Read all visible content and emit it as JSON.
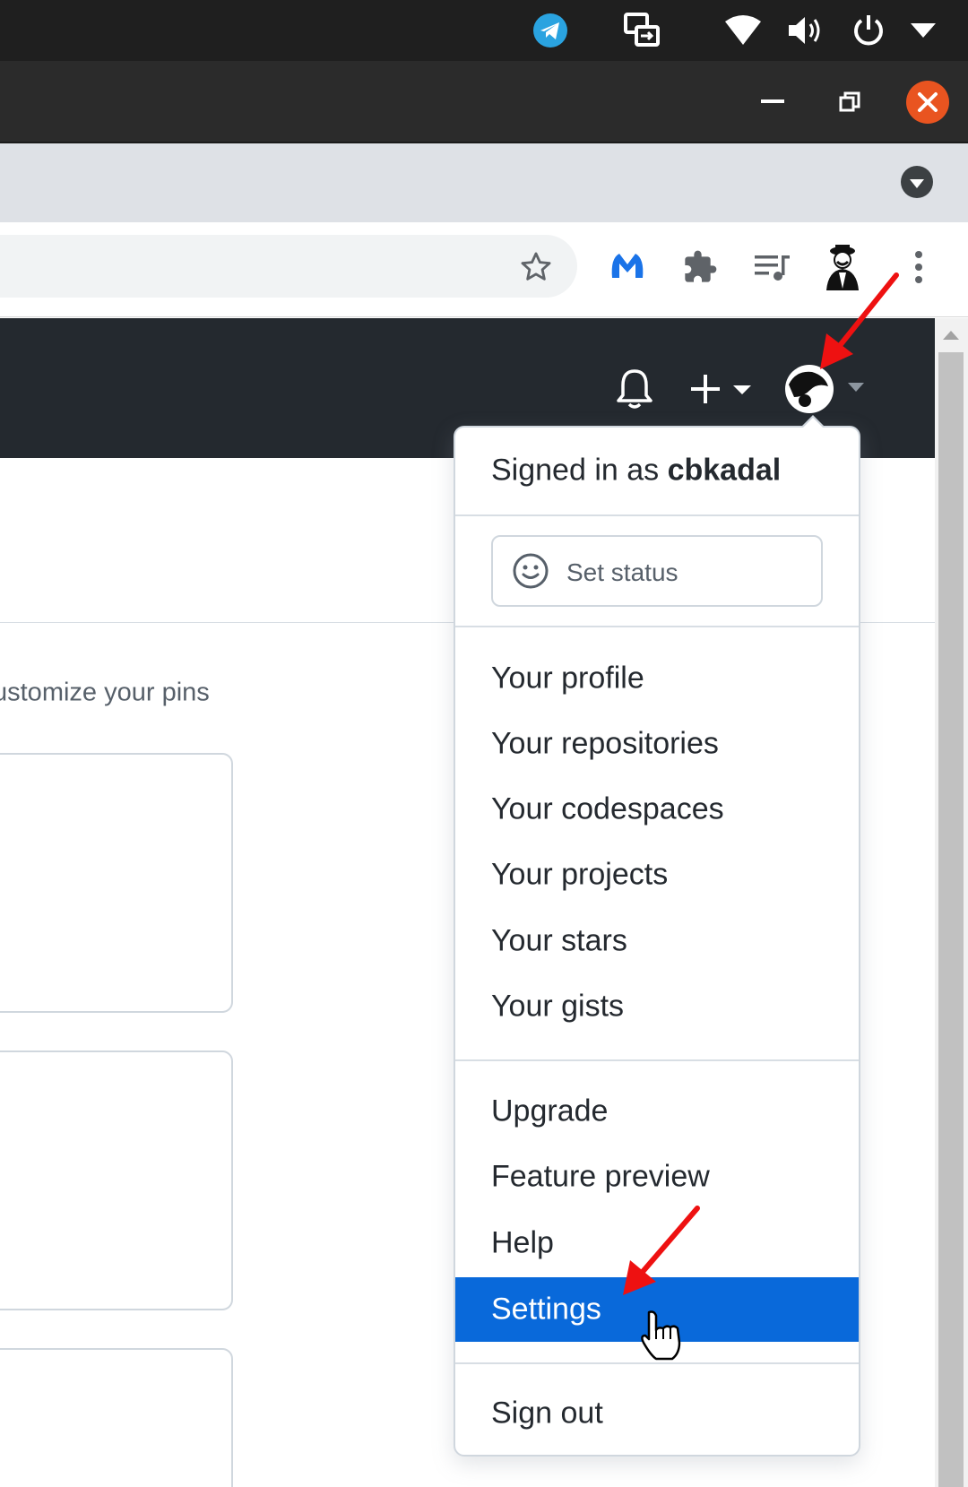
{
  "pins": {
    "customize_link": "ustomize your pins"
  },
  "dropdown": {
    "signed_in_prefix": "Signed in as",
    "username": "cbkadal",
    "set_status": "Set status",
    "section1": [
      "Your profile",
      "Your repositories",
      "Your codespaces",
      "Your projects",
      "Your stars",
      "Your gists"
    ],
    "section2": [
      "Upgrade",
      "Feature preview",
      "Help",
      "Settings"
    ],
    "active_item": "Settings",
    "sign_out": "Sign out"
  },
  "icons": {
    "os_bar": [
      "telegram-icon",
      "screen-share-icon",
      "wifi-icon",
      "volume-icon",
      "power-icon",
      "chevron-down-icon"
    ],
    "window": [
      "minimize-icon",
      "restore-icon",
      "close-icon"
    ],
    "toolbar": [
      "star-icon",
      "malwarebytes-icon",
      "extensions-icon",
      "media-queue-icon",
      "profile-avatar-icon",
      "kebab-menu-icon"
    ],
    "github_header": [
      "bell-icon",
      "plus-icon",
      "avatar-icon"
    ]
  },
  "colors": {
    "accent_blue": "#0969da",
    "close_button": "#e95420",
    "header_dark": "#24292f",
    "annotation_red": "#ee1111"
  }
}
